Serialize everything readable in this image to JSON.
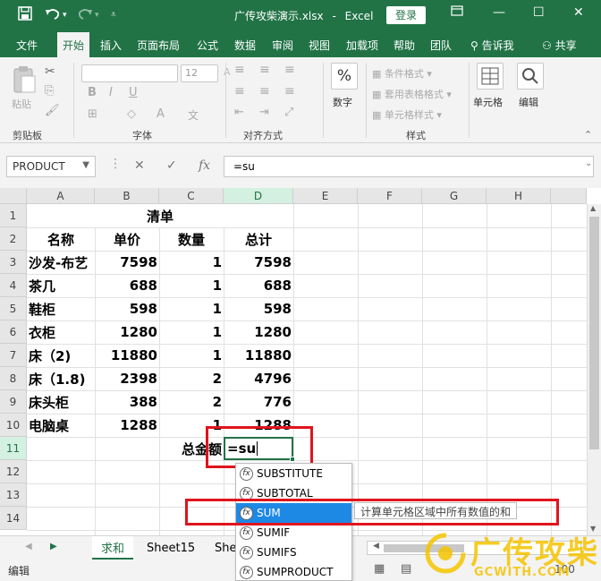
{
  "title_bar": {
    "filename": "广传攻柴演示.xlsx",
    "separator": "-",
    "app": "Excel",
    "login": "登录",
    "undo_icon": "undo-icon",
    "redo_icon": "redo-icon"
  },
  "tabs": [
    "文件",
    "开始",
    "插入",
    "页面布局",
    "公式",
    "数据",
    "审阅",
    "视图",
    "加载项",
    "帮助",
    "团队"
  ],
  "tell_me": "告诉我",
  "share": "共享",
  "ribbon": {
    "paste": "粘贴",
    "clipboard": "剪贴板",
    "font_size": "12",
    "font_group": "字体",
    "align_group": "对齐方式",
    "number": "数字",
    "cond_format": "条件格式",
    "table_format": "套用表格格式",
    "cell_style": "单元格样式",
    "style_group": "样式",
    "cells": "单元格",
    "edit": "编辑",
    "bold": "B",
    "italic": "I",
    "underline": "U",
    "percent": "%"
  },
  "formula_bar": {
    "name_box": "PRODUCT",
    "fx": "fx",
    "formula": "=su"
  },
  "columns": [
    "A",
    "B",
    "C",
    "D",
    "E",
    "F",
    "G",
    "H"
  ],
  "rows": [
    "1",
    "2",
    "3",
    "4",
    "5",
    "6",
    "7",
    "8",
    "9",
    "10",
    "11",
    "12",
    "13",
    "14"
  ],
  "sheet": {
    "title": "清单",
    "headers": [
      "名称",
      "单价",
      "数量",
      "总计"
    ],
    "data": [
      [
        "沙发-布艺",
        "7598",
        "1",
        "7598"
      ],
      [
        "茶几",
        "688",
        "1",
        "688"
      ],
      [
        "鞋柜",
        "598",
        "1",
        "598"
      ],
      [
        "衣柜",
        "1280",
        "1",
        "1280"
      ],
      [
        "床（2)",
        "11880",
        "1",
        "11880"
      ],
      [
        "床（1.8)",
        "2398",
        "2",
        "4796"
      ],
      [
        "床头柜",
        "388",
        "2",
        "776"
      ],
      [
        "电脑桌",
        "1288",
        "1",
        "1288"
      ]
    ],
    "total_label": "总金额",
    "editing_value": "=su"
  },
  "autocomplete": {
    "items": [
      "SUBSTITUTE",
      "SUBTOTAL",
      "SUM",
      "SUMIF",
      "SUMIFS",
      "SUMPRODUCT"
    ],
    "selected": "SUM",
    "tooltip": "计算单元格区域中所有数值的和",
    "fx_mark": "fx"
  },
  "sheet_tabs": [
    "求和",
    "Sheet15",
    "She"
  ],
  "status": "编辑",
  "zoom": "100",
  "watermark": {
    "text": "广传攻柴",
    "url": "GCWITH.COM"
  },
  "colors": {
    "excel_green": "#217346",
    "highlight": "#e0141e",
    "selection": "#1e88e5"
  }
}
